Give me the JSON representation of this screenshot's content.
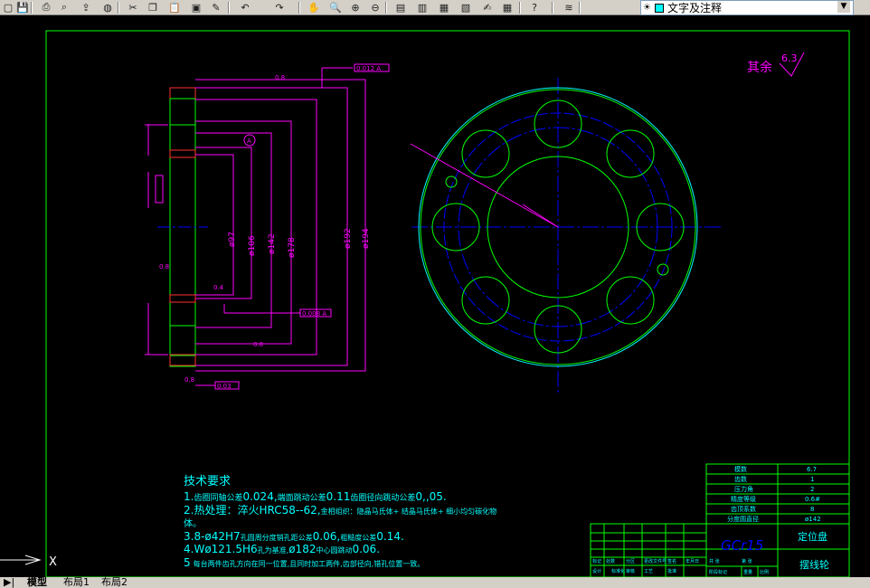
{
  "toolbar": {
    "layer_name": "文字及注释",
    "icons": [
      "new-icon",
      "save-icon",
      "print-icon",
      "print-preview-icon",
      "publish-icon",
      "plot-icon",
      "cut-icon",
      "copy-icon",
      "paste-icon",
      "match-properties-icon",
      "pencil-icon",
      "undo-icon",
      "redo-icon",
      "pan-icon",
      "zoom-realtime-icon",
      "zoom-window-icon",
      "zoom-previous-icon",
      "properties-icon",
      "design-center-icon",
      "tool-palettes-icon",
      "sheet-set-icon",
      "markup-icon",
      "calculator-icon",
      "help-icon",
      "layer-manager-icon"
    ]
  },
  "drawing": {
    "roughness_note": "其余",
    "roughness_value": "6.3",
    "side_view": {
      "dims": [
        "ø97",
        "ø106",
        "ø142",
        "ø178",
        "ø192",
        "ø194"
      ],
      "tolerance_labels": [
        "0.012 A",
        "0.008 A",
        "0.03",
        "0.8",
        "0.8",
        "0.8",
        "0.4",
        "0.8",
        "A"
      ]
    },
    "tech": {
      "title": "技术要求",
      "line1_num": "1.",
      "line1_small_a": "齿圈同轴公差",
      "line1_big_a": "0.024,",
      "line1_small_b": "端面跳动公差",
      "line1_big_b": "0.11",
      "line1_small_c": "齿圈径向跳动公差",
      "line1_big_c": "0,,05.",
      "line2_big": "2.热处理：淬火HRC58--62,",
      "line2_small": "金相组织：隐晶马氏体+ 结晶马氏体+ 细小均匀碳化物",
      "line2_cont": "体。",
      "line3_big_a": "3.8-ø42H7",
      "line3_small": "孔圆周分度销孔距公差",
      "line3_big_b": "0.06,",
      "line3_small_b": "粗糙度公差",
      "line3_big_c": "0.14.",
      "line4_big_a": "4.Wø121.5H6",
      "line4_small": "孔为基准,",
      "line4_big_b": "ø182",
      "line4_small_b": "中心圆跳动",
      "line4_big_c": "0.06.",
      "line5_big": "5",
      "line5_small": "每台两件齿孔方向在同一位置,且同时加工两件,齿部径向,错孔位置一致。"
    },
    "title_block": {
      "rows": [
        {
          "label": "模数",
          "value": "6.7"
        },
        {
          "label": "齿数",
          "value": "1"
        },
        {
          "label": "压力角",
          "value": "2"
        },
        {
          "label": "精度等级",
          "value": "0.6#"
        },
        {
          "label": "齿顶系数",
          "value": "8"
        },
        {
          "label": "分度圆直径",
          "value": "ø142"
        }
      ],
      "material": "GCr15",
      "part_name": "定位盘",
      "drawing_name": "摆线轮",
      "small_cells": [
        "标记",
        "处数",
        "分区",
        "更改文件号",
        "签名",
        "年月日",
        "设计",
        "标准化",
        "阶段标记",
        "重量",
        "比例",
        "审核",
        "工艺",
        "批准",
        "共 张",
        "第 张"
      ]
    },
    "ucs_label": "X"
  },
  "status": {
    "tabs": [
      "模型",
      "布局1",
      "布局2"
    ]
  }
}
